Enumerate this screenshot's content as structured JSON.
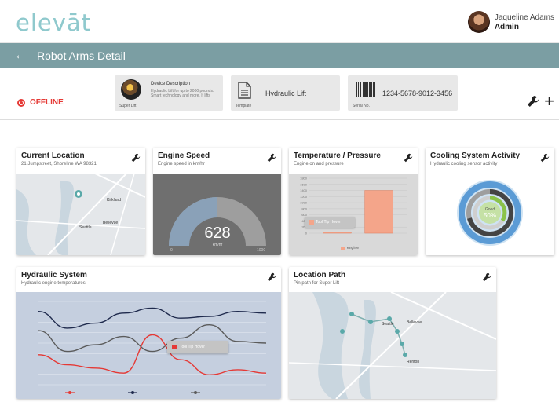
{
  "app": {
    "logo": "elevāt"
  },
  "user": {
    "name": "Jaqueline Adams",
    "role": "Admin"
  },
  "header": {
    "back_icon": "arrow-left-icon",
    "title": "Robot Arms Detail"
  },
  "status": {
    "label": "OFFLINE",
    "color": "#e53935"
  },
  "info_cards": [
    {
      "title": "Device Description",
      "subtitle": "Super Lift",
      "text": "Hydraulic Lift for up to 2000 pounds. Smart technology and more. It lifts"
    },
    {
      "value": "Hydraulic Lift",
      "subtitle": "Template"
    },
    {
      "value": "1234-5678-9012-3456",
      "subtitle": "Serial No."
    }
  ],
  "cards": {
    "current_location": {
      "title": "Current Location",
      "subtitle": "21 Jumpstreet, Shoreline WA 98321",
      "map_labels": [
        "Seattle",
        "Bellevue",
        "Kirkland"
      ]
    },
    "engine_speed": {
      "title": "Engine Speed",
      "subtitle": "Engine speed in km/hr",
      "value": "628",
      "unit": "km/hr",
      "min_label": "0",
      "max_label": "1000"
    },
    "temperature": {
      "title": "Temperature / Pressure",
      "subtitle": "Engine on and pressure",
      "tooltip": "Tool Tip Hover",
      "legend": "engine"
    },
    "cooling": {
      "title": "Cooling System Activity",
      "subtitle": "Hydraulic cooling sensor activity",
      "center_label": "Good",
      "center_value": "50%"
    },
    "hydraulic": {
      "title": "Hydraulic System",
      "subtitle": "Hydraulic engine temperatures",
      "tooltip": "Tool Tip Hover"
    },
    "location_path": {
      "title": "Location Path",
      "subtitle": "Pin path for Super Lift",
      "map_labels": [
        "Seattle",
        "Bellevue",
        "Renton"
      ]
    }
  },
  "chart_data": [
    {
      "type": "bar",
      "title": "Temperature / Pressure",
      "categories": [
        "",
        ""
      ],
      "values": [
        40,
        1400
      ],
      "ylim": [
        0,
        1800
      ],
      "yticks": [
        "0",
        "200",
        "400",
        "600",
        "800",
        "1000",
        "1200",
        "1400",
        "1600",
        "1800"
      ],
      "color": "#f4a58a"
    },
    {
      "type": "line",
      "title": "Hydraulic System",
      "x": [
        0,
        1,
        2,
        3,
        4,
        5,
        6,
        7,
        8
      ],
      "ylim": [
        0,
        100
      ],
      "series": [
        {
          "values": [
            65,
            40,
            48,
            58,
            40,
            56,
            72,
            52,
            50
          ],
          "color": "#5b5b5b"
        },
        {
          "values": [
            88,
            68,
            74,
            86,
            92,
            80,
            82,
            88,
            86
          ],
          "color": "#1f2a4d"
        },
        {
          "values": [
            36,
            24,
            20,
            14,
            60,
            30,
            12,
            18,
            14
          ],
          "color": "#e53935"
        }
      ]
    }
  ]
}
